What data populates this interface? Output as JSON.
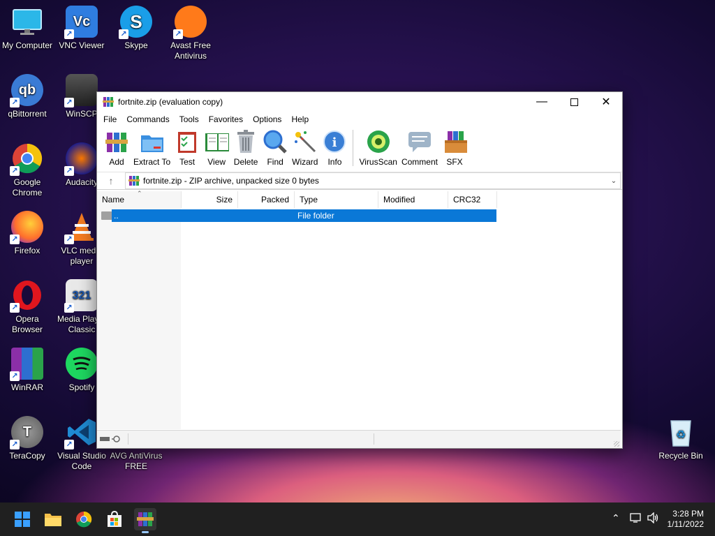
{
  "desktop": {
    "icons": [
      {
        "label": "My Computer"
      },
      {
        "label": "VNC Viewer"
      },
      {
        "label": "Skype"
      },
      {
        "label": "Avast Free Antivirus"
      },
      {
        "label": "qBittorrent"
      },
      {
        "label": "WinSCP"
      },
      {
        "label": "Google Chrome"
      },
      {
        "label": "Audacity"
      },
      {
        "label": "Firefox"
      },
      {
        "label": "VLC media player"
      },
      {
        "label": "Opera Browser"
      },
      {
        "label": "Media Player Classic"
      },
      {
        "label": "WinRAR"
      },
      {
        "label": "Spotify"
      },
      {
        "label": "TeraCopy"
      },
      {
        "label": "Visual Studio Code"
      },
      {
        "label": "AVG AntiVirus FREE"
      },
      {
        "label": "Recycle Bin"
      }
    ]
  },
  "window": {
    "title": "fortnite.zip (evaluation copy)",
    "menu": [
      "File",
      "Commands",
      "Tools",
      "Favorites",
      "Options",
      "Help"
    ],
    "toolbar": [
      "Add",
      "Extract To",
      "Test",
      "View",
      "Delete",
      "Find",
      "Wizard",
      "Info",
      "VirusScan",
      "Comment",
      "SFX"
    ],
    "address": "fortnite.zip - ZIP archive, unpacked size 0 bytes",
    "columns": [
      "Name",
      "Size",
      "Packed",
      "Type",
      "Modified",
      "CRC32"
    ],
    "rows": [
      {
        "name": "..",
        "type": "File folder"
      }
    ]
  },
  "taskbar": {
    "time": "3:28 PM",
    "date": "1/11/2022"
  },
  "colors": {
    "selection": "#0a78d7",
    "taskbar": "#202020"
  }
}
